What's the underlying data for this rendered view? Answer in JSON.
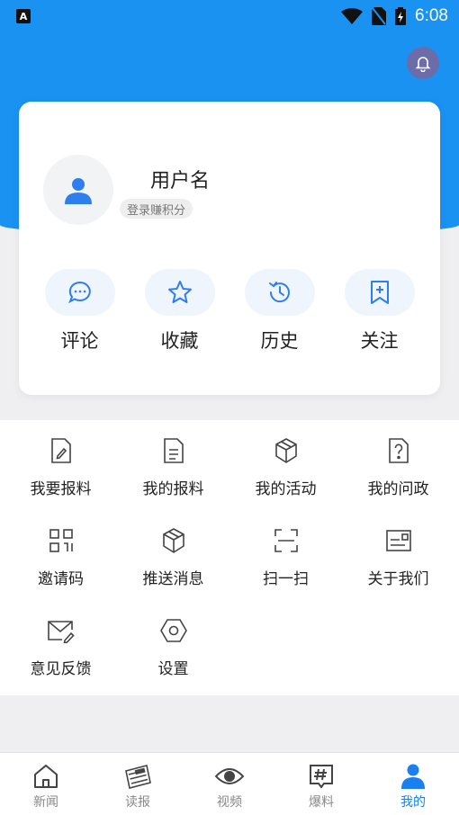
{
  "status_bar": {
    "app_indicator": "A",
    "time": "6:08"
  },
  "colors": {
    "header_blue": "#1a92f2",
    "accent_blue": "#2f7ef0",
    "bell_bg": "#6b6ca8"
  },
  "profile": {
    "username": "用户名",
    "login_badge": "登录赚积分",
    "quick_actions": [
      {
        "label": "评论",
        "icon": "comment-icon"
      },
      {
        "label": "收藏",
        "icon": "star-icon"
      },
      {
        "label": "历史",
        "icon": "history-icon"
      },
      {
        "label": "关注",
        "icon": "bookmark-plus-icon"
      }
    ]
  },
  "menu": {
    "items": [
      {
        "label": "我要报料",
        "icon": "edit-doc-icon"
      },
      {
        "label": "我的报料",
        "icon": "doc-list-icon"
      },
      {
        "label": "我的活动",
        "icon": "cube-icon"
      },
      {
        "label": "我的问政",
        "icon": "question-doc-icon"
      },
      {
        "label": "邀请码",
        "icon": "qr-grid-icon"
      },
      {
        "label": "推送消息",
        "icon": "cube-push-icon"
      },
      {
        "label": "扫一扫",
        "icon": "scan-icon"
      },
      {
        "label": "关于我们",
        "icon": "id-card-icon"
      },
      {
        "label": "意见反馈",
        "icon": "mail-edit-icon"
      },
      {
        "label": "设置",
        "icon": "hexagon-settings-icon"
      }
    ]
  },
  "bottom_nav": {
    "items": [
      {
        "label": "新闻",
        "icon": "home-icon"
      },
      {
        "label": "读报",
        "icon": "newspaper-icon"
      },
      {
        "label": "视频",
        "icon": "eye-icon"
      },
      {
        "label": "爆料",
        "icon": "hashtag-icon"
      },
      {
        "label": "我的",
        "icon": "user-icon",
        "active": true
      }
    ]
  }
}
